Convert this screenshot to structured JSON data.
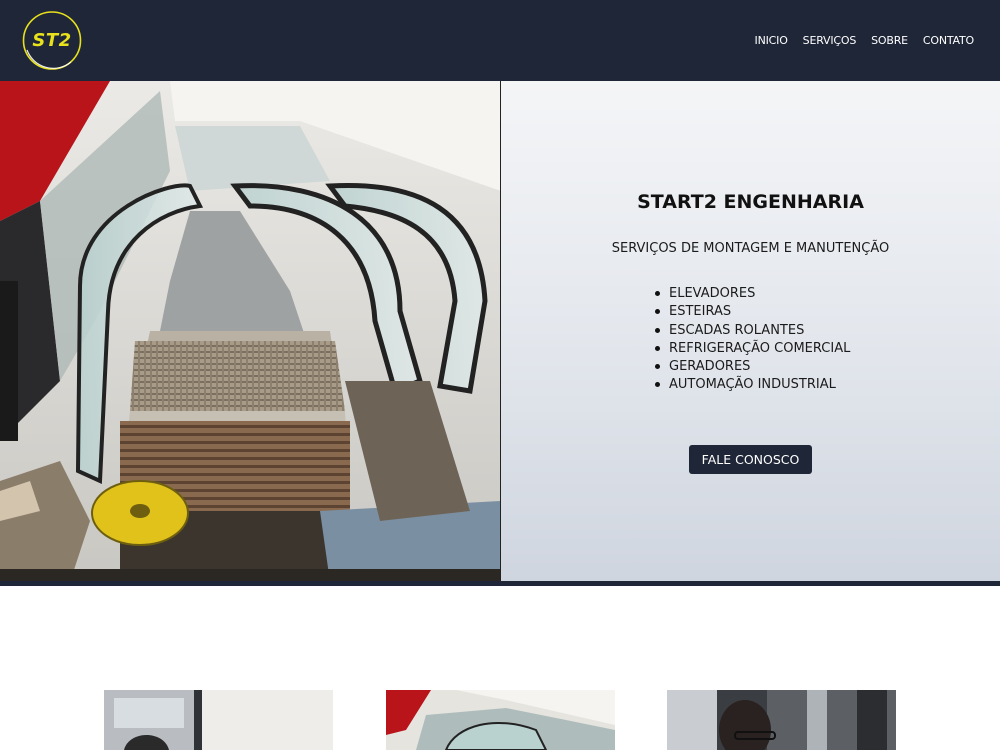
{
  "header": {
    "logo_text": "ST2",
    "nav": [
      {
        "label": "INICIO"
      },
      {
        "label": "SERVIÇOS"
      },
      {
        "label": "SOBRE"
      },
      {
        "label": "CONTATO"
      }
    ]
  },
  "hero": {
    "title": "START2 ENGENHARIA",
    "subtitle": "SERVIÇOS DE MONTAGEM E MANUTENÇÃO",
    "services": [
      "ELEVADORES",
      "ESTEIRAS",
      "ESCADAS ROLANTES",
      "REFRIGERAÇÃO COMERCIAL",
      "GERADORES",
      "AUTOMAÇÃO INDUSTRIAL"
    ],
    "cta_label": "FALE CONOSCO"
  },
  "colors": {
    "brand_dark": "#1f2638",
    "logo_accent": "#e8e21c",
    "panel_light": "#f4f5f7",
    "panel_shade": "#cfd5df"
  }
}
